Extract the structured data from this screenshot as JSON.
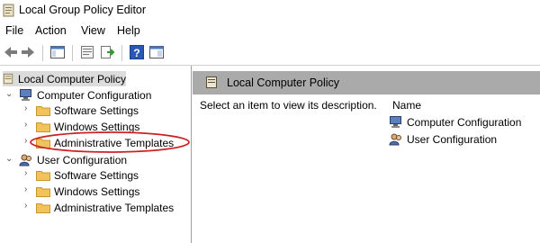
{
  "window": {
    "title": "Local Group Policy Editor"
  },
  "menu": {
    "items": [
      "File",
      "Action",
      "View",
      "Help"
    ]
  },
  "toolbar": {
    "buttons": [
      "back-arrow-icon",
      "forward-arrow-icon",
      "console-tree-icon",
      "properties-icon",
      "export-list-icon",
      "help-icon",
      "show-hide-pane-icon"
    ]
  },
  "tree": {
    "root": "Local Computer Policy",
    "computer": {
      "label": "Computer Configuration",
      "children": [
        "Software Settings",
        "Windows Settings",
        "Administrative Templates"
      ]
    },
    "user": {
      "label": "User Configuration",
      "children": [
        "Software Settings",
        "Windows Settings",
        "Administrative Templates"
      ]
    }
  },
  "details": {
    "header": "Local Computer Policy",
    "description": "Select an item to view its description.",
    "column_name": "Name",
    "items": [
      "Computer Configuration",
      "User Configuration"
    ]
  },
  "colors": {
    "header_bg": "#aaaaaa",
    "selection_bg": "#dcdcdc",
    "annotation_ellipse": "#cc2222",
    "folder": "#f2c35a"
  }
}
